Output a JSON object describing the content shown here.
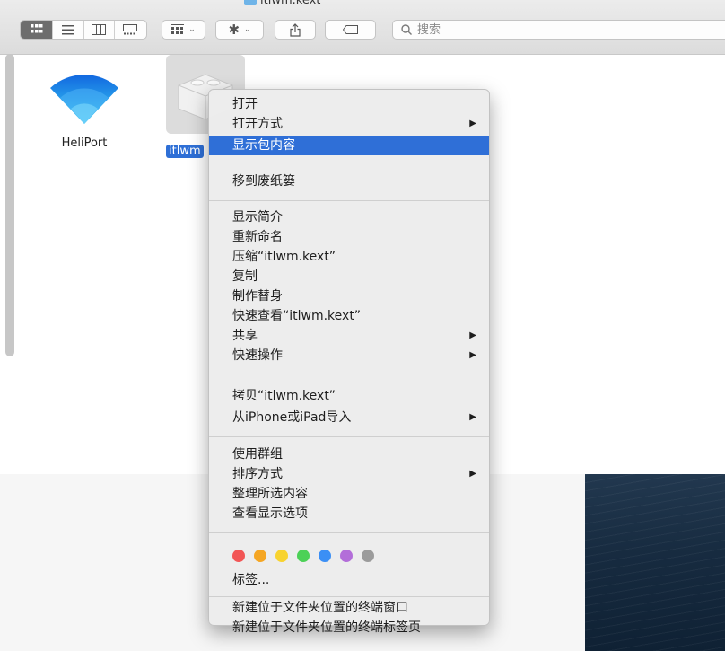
{
  "window": {
    "title": "itlwm.kext"
  },
  "toolbar": {
    "view_icons": [
      "icon-view-icon",
      "list-view-icon",
      "column-view-icon",
      "gallery-view-icon"
    ],
    "search_placeholder": "搜索"
  },
  "files": [
    {
      "name": "HeliPort"
    },
    {
      "name": "itlwm"
    }
  ],
  "menu": {
    "items": [
      {
        "label": "打开"
      },
      {
        "label": "打开方式"
      },
      {
        "label": "显示包内容"
      },
      {
        "label": "移到废纸篓"
      },
      {
        "label": "显示简介"
      },
      {
        "label": "重新命名"
      },
      {
        "label": "压缩“itlwm.kext”"
      },
      {
        "label": "复制"
      },
      {
        "label": "制作替身"
      },
      {
        "label": "快速查看“itlwm.kext”"
      },
      {
        "label": "共享"
      },
      {
        "label": "快速操作"
      },
      {
        "label": "拷贝“itlwm.kext”"
      },
      {
        "label": "从iPhone或iPad导入"
      },
      {
        "label": "使用群组"
      },
      {
        "label": "排序方式"
      },
      {
        "label": "整理所选内容"
      },
      {
        "label": "查看显示选项"
      },
      {
        "label": "标签..."
      },
      {
        "label": "新建位于文件夹位置的终端窗口"
      },
      {
        "label": "新建位于文件夹位置的终端标签页"
      }
    ],
    "tag_colors": [
      "#f25656",
      "#f5a623",
      "#f8d32f",
      "#4cd157",
      "#3b8ff5",
      "#b36ed9",
      "#9b9b9b"
    ]
  }
}
